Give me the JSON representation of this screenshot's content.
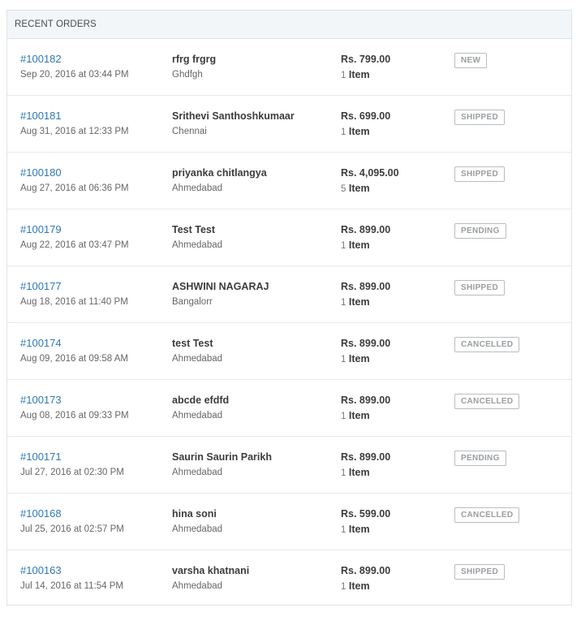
{
  "header": {
    "title": "RECENT ORDERS"
  },
  "orders": [
    {
      "id": "#100182",
      "date": "Sep 20, 2016 at 03:44 PM",
      "customer": "rfrg frgrg",
      "city": "Ghdfgh",
      "amount": "Rs. 799.00",
      "qty": "1",
      "items_label": "Item",
      "status": "NEW"
    },
    {
      "id": "#100181",
      "date": "Aug 31, 2016 at 12:33 PM",
      "customer": "Srithevi Santhoshkumaar",
      "city": "Chennai",
      "amount": "Rs. 699.00",
      "qty": "1",
      "items_label": "Item",
      "status": "SHIPPED"
    },
    {
      "id": "#100180",
      "date": "Aug 27, 2016 at 06:36 PM",
      "customer": "priyanka chitlangya",
      "city": "Ahmedabad",
      "amount": "Rs. 4,095.00",
      "qty": "5",
      "items_label": "Item",
      "status": "SHIPPED"
    },
    {
      "id": "#100179",
      "date": "Aug 22, 2016 at 03:47 PM",
      "customer": "Test Test",
      "city": "Ahmedabad",
      "amount": "Rs. 899.00",
      "qty": "1",
      "items_label": "Item",
      "status": "PENDING"
    },
    {
      "id": "#100177",
      "date": "Aug 18, 2016 at 11:40 PM",
      "customer": "ASHWINI NAGARAJ",
      "city": "Bangalorr",
      "amount": "Rs. 899.00",
      "qty": "1",
      "items_label": "Item",
      "status": "SHIPPED"
    },
    {
      "id": "#100174",
      "date": "Aug 09, 2016 at 09:58 AM",
      "customer": "test Test",
      "city": "Ahmedabad",
      "amount": "Rs. 899.00",
      "qty": "1",
      "items_label": "Item",
      "status": "CANCELLED"
    },
    {
      "id": "#100173",
      "date": "Aug 08, 2016 at 09:33 PM",
      "customer": "abcde efdfd",
      "city": "Ahmedabad",
      "amount": "Rs. 899.00",
      "qty": "1",
      "items_label": "Item",
      "status": "CANCELLED"
    },
    {
      "id": "#100171",
      "date": "Jul 27, 2016 at 02:30 PM",
      "customer": "Saurin Saurin Parikh",
      "city": "Ahmedabad",
      "amount": "Rs. 899.00",
      "qty": "1",
      "items_label": "Item",
      "status": "PENDING"
    },
    {
      "id": "#100168",
      "date": "Jul 25, 2016 at 02:57 PM",
      "customer": "hina soni",
      "city": "Ahmedabad",
      "amount": "Rs. 599.00",
      "qty": "1",
      "items_label": "Item",
      "status": "CANCELLED"
    },
    {
      "id": "#100163",
      "date": "Jul 14, 2016 at 11:54 PM",
      "customer": "varsha khatnani",
      "city": "Ahmedabad",
      "amount": "Rs. 899.00",
      "qty": "1",
      "items_label": "Item",
      "status": "SHIPPED"
    }
  ],
  "colors": {
    "link": "#2d78b7",
    "header_bg": "#f3f6f9",
    "border": "#dde1e5",
    "badge_text": "#9a9da0",
    "badge_border": "#b9bcbf"
  }
}
